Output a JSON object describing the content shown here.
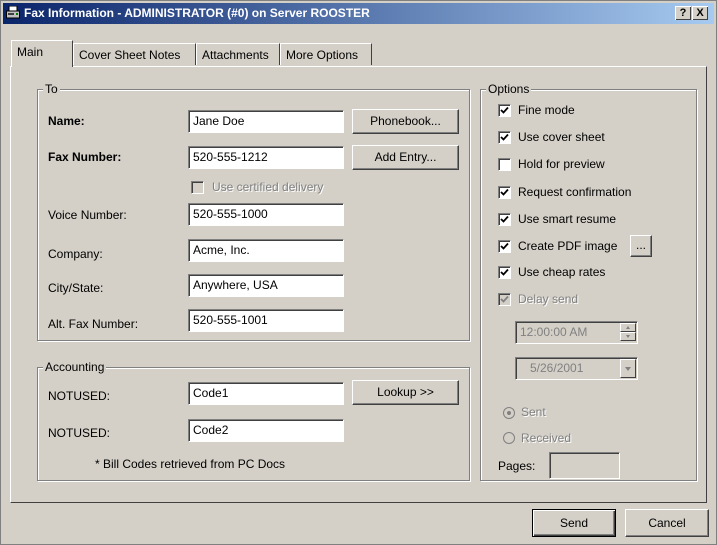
{
  "window": {
    "title": "Fax Information - ADMINISTRATOR (#0) on Server ROOSTER",
    "help_button": "?",
    "close_button": "X"
  },
  "tabs": [
    {
      "label": "Main",
      "active": true
    },
    {
      "label": "Cover Sheet Notes",
      "active": false
    },
    {
      "label": "Attachments",
      "active": false
    },
    {
      "label": "More Options",
      "active": false
    }
  ],
  "to": {
    "group_label": "To",
    "name": {
      "label": "Name:",
      "value": "Jane Doe"
    },
    "fax_number": {
      "label": "Fax Number:",
      "value": "520-555-1212"
    },
    "phonebook_button": "Phonebook...",
    "add_entry_button": "Add Entry...",
    "certified_delivery": {
      "label": "Use certified delivery",
      "checked": false,
      "enabled": false
    },
    "voice_number": {
      "label": "Voice Number:",
      "value": "520-555-1000"
    },
    "company": {
      "label": "Company:",
      "value": "Acme, Inc."
    },
    "city_state": {
      "label": "City/State:",
      "value": "Anywhere, USA"
    },
    "alt_fax_number": {
      "label": "Alt. Fax Number:",
      "value": "520-555-1001"
    }
  },
  "accounting": {
    "group_label": "Accounting",
    "field1": {
      "label": "NOTUSED:",
      "value": "Code1"
    },
    "field2": {
      "label": "NOTUSED:",
      "value": "Code2"
    },
    "lookup_button": "Lookup  >>",
    "note": "* Bill Codes retrieved from PC Docs"
  },
  "options": {
    "group_label": "Options",
    "fine_mode": {
      "label": "Fine mode",
      "checked": true
    },
    "use_cover_sheet": {
      "label": "Use cover sheet",
      "checked": true
    },
    "hold_for_preview": {
      "label": "Hold for preview",
      "checked": false
    },
    "request_confirmation": {
      "label": "Request confirmation",
      "checked": true
    },
    "use_smart_resume": {
      "label": "Use smart resume",
      "checked": true
    },
    "create_pdf_image": {
      "label": "Create PDF image",
      "checked": true
    },
    "pdf_options_button": "...",
    "use_cheap_rates": {
      "label": "Use cheap rates",
      "checked": true
    },
    "delay_send": {
      "label": "Delay send",
      "checked": true,
      "enabled": false
    },
    "delay_time": "12:00:00 AM",
    "delay_date": "5/26/2001",
    "sent": {
      "label": "Sent",
      "selected": true
    },
    "received": {
      "label": "Received",
      "selected": false
    },
    "pages_label": "Pages:",
    "pages_value": ""
  },
  "footer": {
    "send_button": "Send",
    "cancel_button": "Cancel"
  }
}
